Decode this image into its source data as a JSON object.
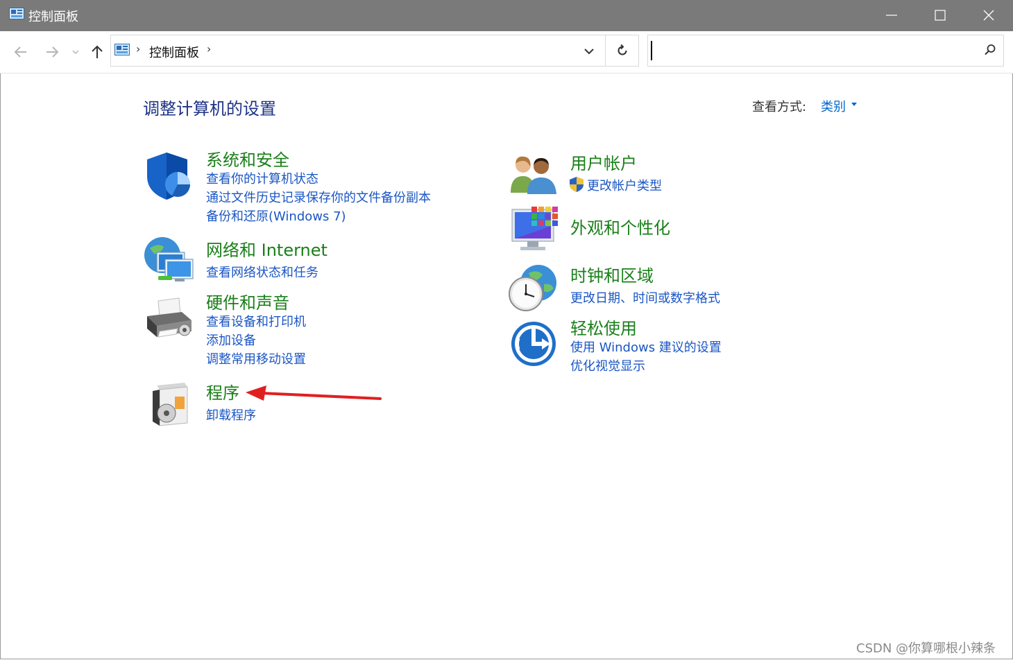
{
  "window": {
    "title": "控制面板",
    "minimize_icon": "minimize-icon",
    "maximize_icon": "maximize-icon",
    "close_icon": "close-icon"
  },
  "nav": {
    "breadcrumb_root": "控制面板",
    "separator": "›",
    "search_value": ""
  },
  "heading": "调整计算机的设置",
  "view_by": {
    "label": "查看方式:",
    "value": "类别"
  },
  "left_categories": [
    {
      "title": "系统和安全",
      "links": [
        "查看你的计算机状态",
        "通过文件历史记录保存你的文件备份副本",
        "备份和还原(Windows 7)"
      ],
      "icon": "shield-icon"
    },
    {
      "title": "网络和 Internet",
      "links": [
        "查看网络状态和任务"
      ],
      "icon": "network-globe-icon"
    },
    {
      "title": "硬件和声音",
      "links": [
        "查看设备和打印机",
        "添加设备",
        "调整常用移动设置"
      ],
      "icon": "printer-icon"
    },
    {
      "title": "程序",
      "links": [
        "卸载程序"
      ],
      "icon": "programs-disc-icon"
    }
  ],
  "right_categories": [
    {
      "title": "用户帐户",
      "links": [
        "更改帐户类型"
      ],
      "icon": "users-icon"
    },
    {
      "title": "外观和个性化",
      "links": [],
      "icon": "monitor-palette-icon"
    },
    {
      "title": "时钟和区域",
      "links": [
        "更改日期、时间或数字格式"
      ],
      "icon": "clock-globe-icon"
    },
    {
      "title": "轻松使用",
      "links": [
        "使用 Windows 建议的设置",
        "优化视觉显示"
      ],
      "icon": "ease-of-access-icon"
    }
  ],
  "colors": {
    "titlebar": "#7a7a7a",
    "heading": "#1e3287",
    "category_title": "#1a7f1a",
    "link": "#1a56c4",
    "annotation_arrow": "#e02020"
  },
  "watermark": "CSDN @你算哪根小辣条"
}
